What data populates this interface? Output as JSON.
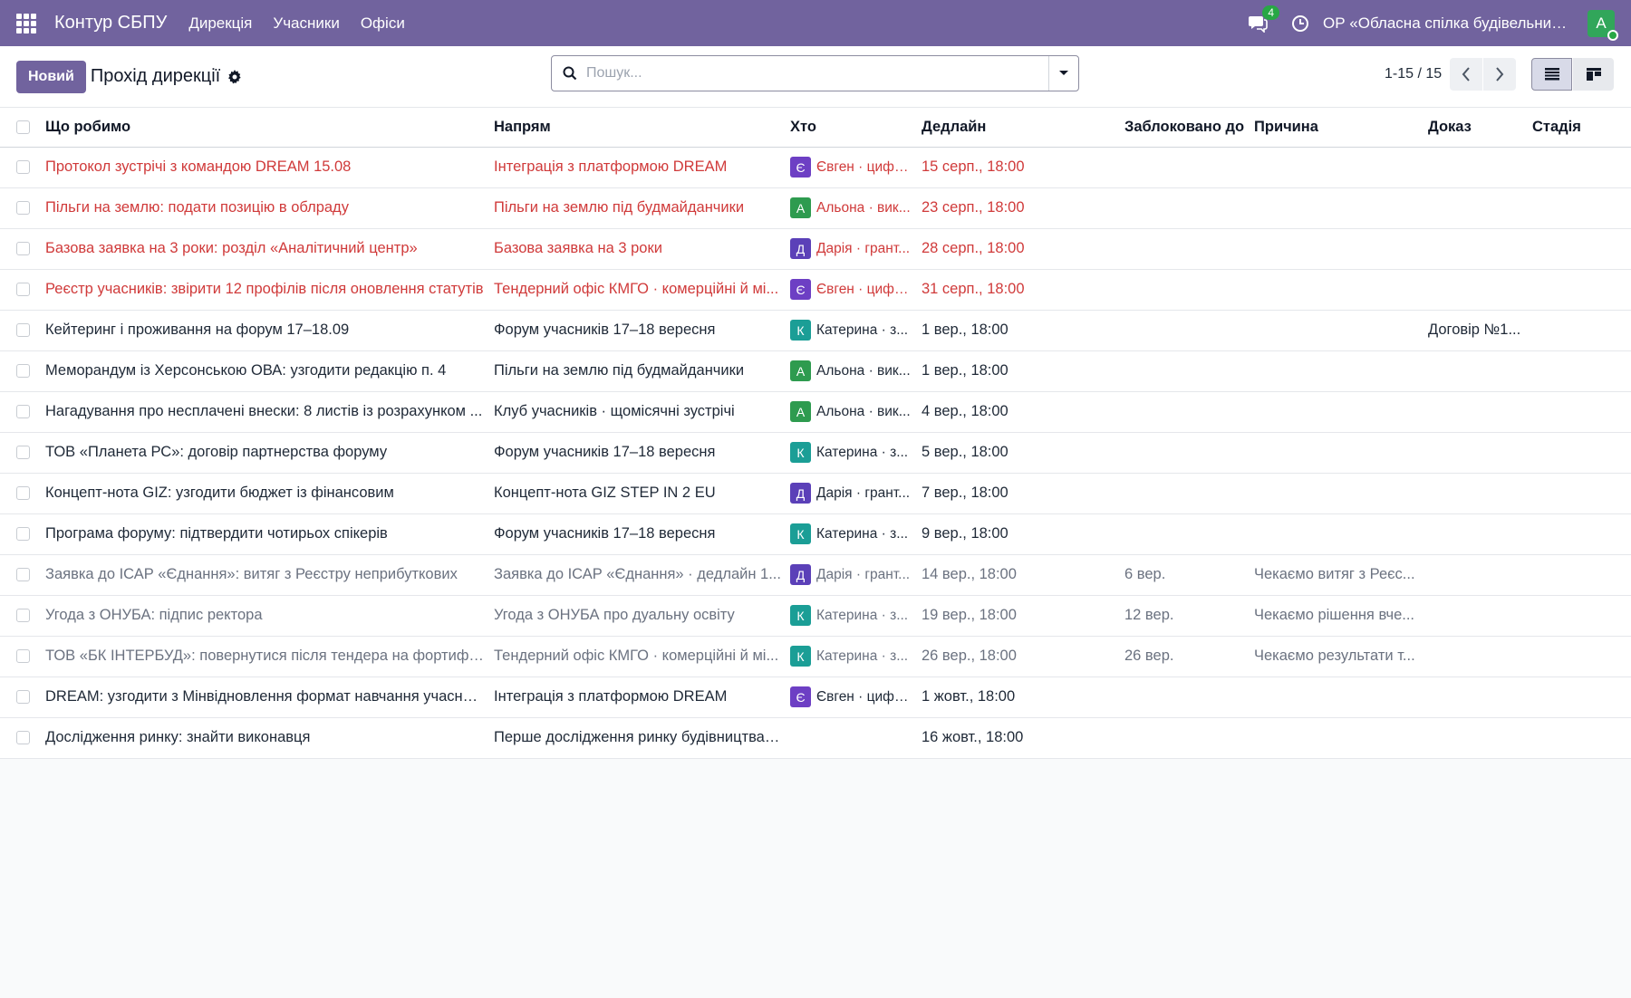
{
  "navbar": {
    "brand": "Контур СБПУ",
    "menu": [
      "Дирекція",
      "Учасники",
      "Офіси"
    ],
    "chat_count": "4",
    "company": "ОР «Обласна спілка будівельникі...",
    "user_initial": "А",
    "colors": {
      "bg": "#71639e",
      "avatar": "#31a65a"
    }
  },
  "control": {
    "new_label": "Новий",
    "title": "Прохід дирекції",
    "search_placeholder": "Пошук...",
    "pager": "1-15 / 15"
  },
  "columns": [
    "Що робимо",
    "Напрям",
    "Хто",
    "Дедлайн",
    "Заблоковано до",
    "Причина",
    "Доказ",
    "Стадія"
  ],
  "avatar_colors": {
    "Є": "#6d3fc4",
    "А": "#2e9b4f",
    "Д": "#5b40b8",
    "К": "#1b9e96"
  },
  "rows": [
    {
      "what": "Протокол зустрічі з командою DREAM 15.08",
      "direction": "Інтеграція з платформою DREAM",
      "who_initial": "Є",
      "who": "Євген · цифр...",
      "deadline": "15 серп., 18:00",
      "blocked": "",
      "reason": "",
      "proof": "",
      "stage": "",
      "state": "late"
    },
    {
      "what": "Пільги на землю: подати позицію в облраду",
      "direction": "Пільги на землю під будмайданчики",
      "who_initial": "А",
      "who": "Альона · вик...",
      "deadline": "23 серп., 18:00",
      "blocked": "",
      "reason": "",
      "proof": "",
      "stage": "",
      "state": "late"
    },
    {
      "what": "Базова заявка на 3 роки: розділ «Аналітичний центр»",
      "direction": "Базова заявка на 3 роки",
      "who_initial": "Д",
      "who": "Дарія · грант...",
      "deadline": "28 серп., 18:00",
      "blocked": "",
      "reason": "",
      "proof": "",
      "stage": "",
      "state": "late"
    },
    {
      "what": "Реєстр учасників: звірити 12 профілів після оновлення статутів",
      "direction": "Тендерний офіс КМГО · комерційні й мі...",
      "who_initial": "Є",
      "who": "Євген · цифр...",
      "deadline": "31 серп., 18:00",
      "blocked": "",
      "reason": "",
      "proof": "",
      "stage": "",
      "state": "late"
    },
    {
      "what": "Кейтеринг і проживання на форум 17–18.09",
      "direction": "Форум учасників 17–18 вересня",
      "who_initial": "К",
      "who": "Катерина · з...",
      "deadline": "1 вер., 18:00",
      "blocked": "",
      "reason": "",
      "proof": "Договір №1...",
      "stage": "",
      "state": "normal"
    },
    {
      "what": "Меморандум із Херсонською ОВА: узгодити редакцію п. 4",
      "direction": "Пільги на землю під будмайданчики",
      "who_initial": "А",
      "who": "Альона · вик...",
      "deadline": "1 вер., 18:00",
      "blocked": "",
      "reason": "",
      "proof": "",
      "stage": "",
      "state": "normal"
    },
    {
      "what": "Нагадування про несплачені внески: 8 листів із розрахунком ...",
      "direction": "Клуб учасників · щомісячні зустрічі",
      "who_initial": "А",
      "who": "Альона · вик...",
      "deadline": "4 вер., 18:00",
      "blocked": "",
      "reason": "",
      "proof": "",
      "stage": "",
      "state": "normal"
    },
    {
      "what": "ТОВ «Планета РС»: договір партнерства форуму",
      "direction": "Форум учасників 17–18 вересня",
      "who_initial": "К",
      "who": "Катерина · з...",
      "deadline": "5 вер., 18:00",
      "blocked": "",
      "reason": "",
      "proof": "",
      "stage": "",
      "state": "normal"
    },
    {
      "what": "Концепт-нота GIZ: узгодити бюджет із фінансовим",
      "direction": "Концепт-нота GIZ STEP IN 2 EU",
      "who_initial": "Д",
      "who": "Дарія · грант...",
      "deadline": "7 вер., 18:00",
      "blocked": "",
      "reason": "",
      "proof": "",
      "stage": "",
      "state": "normal"
    },
    {
      "what": "Програма форуму: підтвердити чотирьох спікерів",
      "direction": "Форум учасників 17–18 вересня",
      "who_initial": "К",
      "who": "Катерина · з...",
      "deadline": "9 вер., 18:00",
      "blocked": "",
      "reason": "",
      "proof": "",
      "stage": "",
      "state": "normal"
    },
    {
      "what": "Заявка до ІСАР «Єднання»: витяг з Реєстру неприбуткових",
      "direction": "Заявка до ІСАР «Єднання» · дедлайн 1...",
      "who_initial": "Д",
      "who": "Дарія · грант...",
      "deadline": "14 вер., 18:00",
      "blocked": "6 вер.",
      "reason": "Чекаємо витяг з Реєс...",
      "proof": "",
      "stage": "",
      "state": "blocked"
    },
    {
      "what": "Угода з ОНУБА: підпис ректора",
      "direction": "Угода з ОНУБА про дуальну освіту",
      "who_initial": "К",
      "who": "Катерина · з...",
      "deadline": "19 вер., 18:00",
      "blocked": "12 вер.",
      "reason": "Чекаємо рішення вче...",
      "proof": "",
      "stage": "",
      "state": "blocked"
    },
    {
      "what": "ТОВ «БК ІНТЕРБУД»: повернутися після тендера на фортифік...",
      "direction": "Тендерний офіс КМГО · комерційні й мі...",
      "who_initial": "К",
      "who": "Катерина · з...",
      "deadline": "26 вер., 18:00",
      "blocked": "26 вер.",
      "reason": "Чекаємо результати т...",
      "proof": "",
      "stage": "",
      "state": "blocked"
    },
    {
      "what": "DREAM: узгодити з Мінвідновлення формат навчання учасників",
      "direction": "Інтеграція з платформою DREAM",
      "who_initial": "Є",
      "who": "Євген · цифр...",
      "deadline": "1 жовт., 18:00",
      "blocked": "",
      "reason": "",
      "proof": "",
      "stage": "",
      "state": "normal"
    },
    {
      "what": "Дослідження ринку: знайти виконавця",
      "direction": "Перше дослідження ринку будівництва ...",
      "who_initial": "",
      "who": "",
      "deadline": "16 жовт., 18:00",
      "blocked": "",
      "reason": "",
      "proof": "",
      "stage": "",
      "state": "normal"
    }
  ]
}
